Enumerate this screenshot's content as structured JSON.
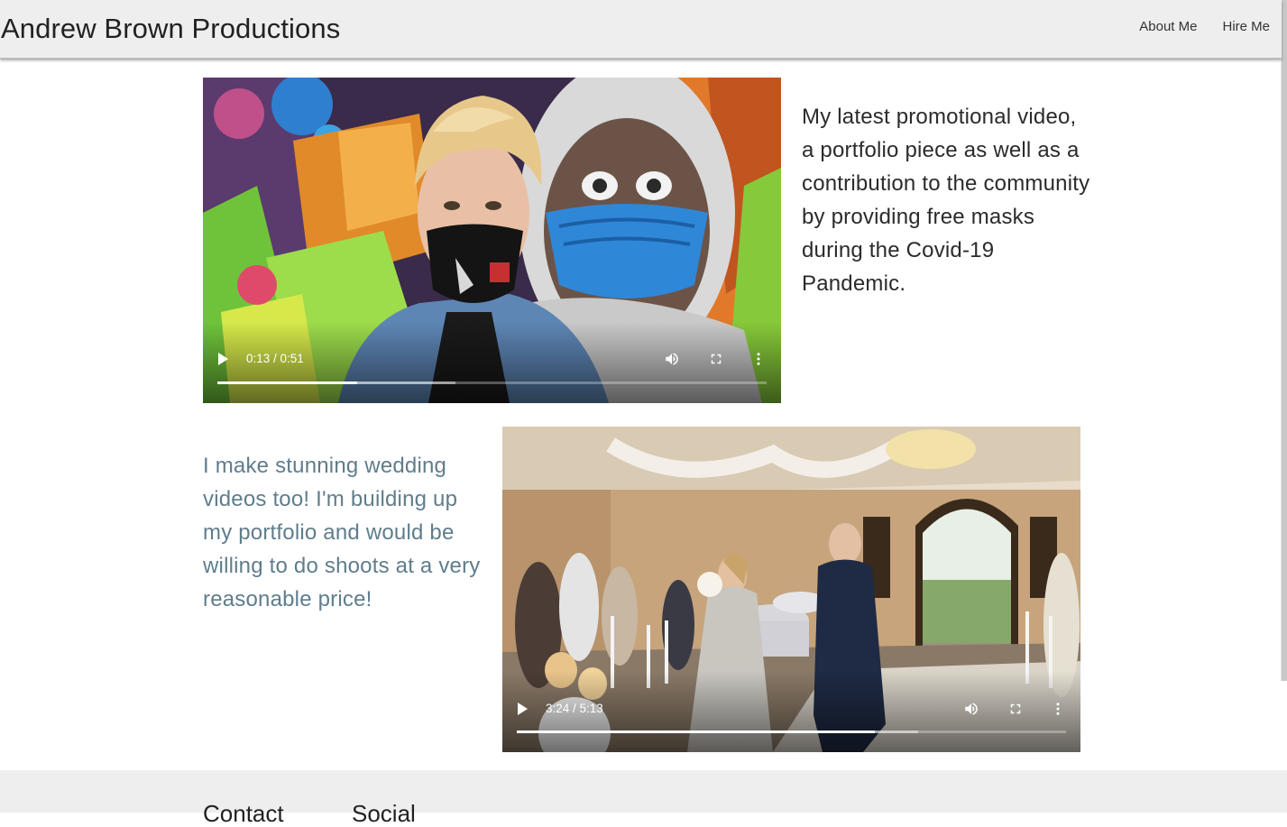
{
  "header": {
    "brand": "Andrew Brown Productions",
    "nav": [
      "About Me",
      "Hire Me"
    ]
  },
  "videos": [
    {
      "time": "0:13 / 0:51",
      "progress": 0.2541,
      "buffered": 0.4336,
      "description": "My latest promotional video, a portfolio piece as well as a contribution to the community by providing free masks during the Covid-19 Pandemic."
    },
    {
      "time": "3:24 / 5:13",
      "progress": 0.6518,
      "buffered": 0.7311,
      "description": "I make stunning wedding videos too! I'm building up my portfolio and would be willing to do shoots at a very reasonable price!"
    }
  ],
  "footer": {
    "headings": [
      "Contact",
      "Social"
    ]
  },
  "colors": {
    "navbar_bg": "#eeeeee",
    "description_accent": "#5f7d8c",
    "footer_bg": "#eeeeee"
  },
  "icons": [
    "play-icon",
    "volume-icon",
    "fullscreen-icon",
    "more-options-icon"
  ]
}
